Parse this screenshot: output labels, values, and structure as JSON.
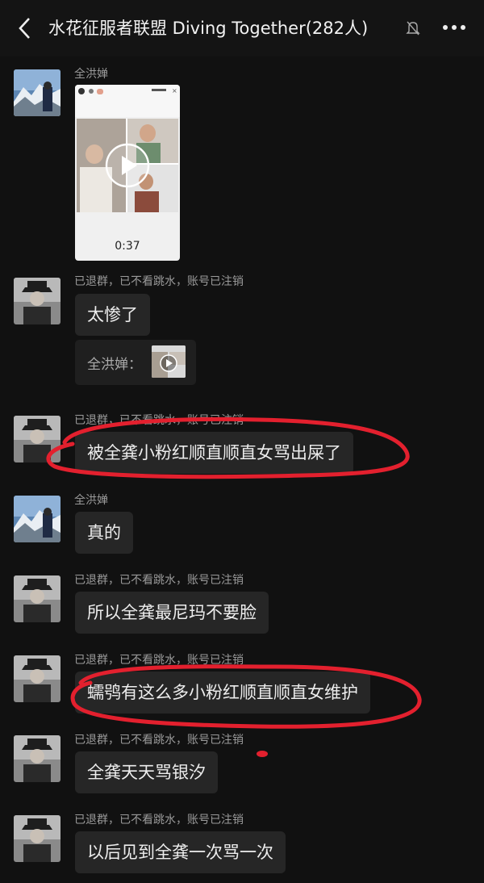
{
  "header": {
    "title": "水花征服者联盟 Diving Together(282人)",
    "icons": [
      "back-icon",
      "bell-muted-icon",
      "more-icon"
    ]
  },
  "messages": [
    {
      "sender": "全洪婵",
      "type": "video",
      "duration": "0:37"
    },
    {
      "sender": "已退群，已不看跳水，账号已注销",
      "text": "太惨了",
      "quote_label": "全洪婵："
    },
    {
      "sender": "已退群，已不看跳水，账号已注销",
      "text": "被全龚小粉红顺直顺直女骂出屎了"
    },
    {
      "sender": "全洪婵",
      "text": "真的"
    },
    {
      "sender": "已退群，已不看跳水，账号已注销",
      "text": "所以全龚最尼玛不要脸"
    },
    {
      "sender": "已退群，已不看跳水，账号已注销",
      "text": "蠕鸮有这么多小粉红顺直顺直女维护"
    },
    {
      "sender": "已退群，已不看跳水，账号已注销",
      "text": "全龚天天骂银汐"
    },
    {
      "sender": "已退群，已不看跳水，账号已注销",
      "text": "以后见到全龚一次骂一次"
    }
  ],
  "colors": {
    "background": "#111111",
    "bubble": "#262626",
    "annotation_red": "#e3202e"
  }
}
